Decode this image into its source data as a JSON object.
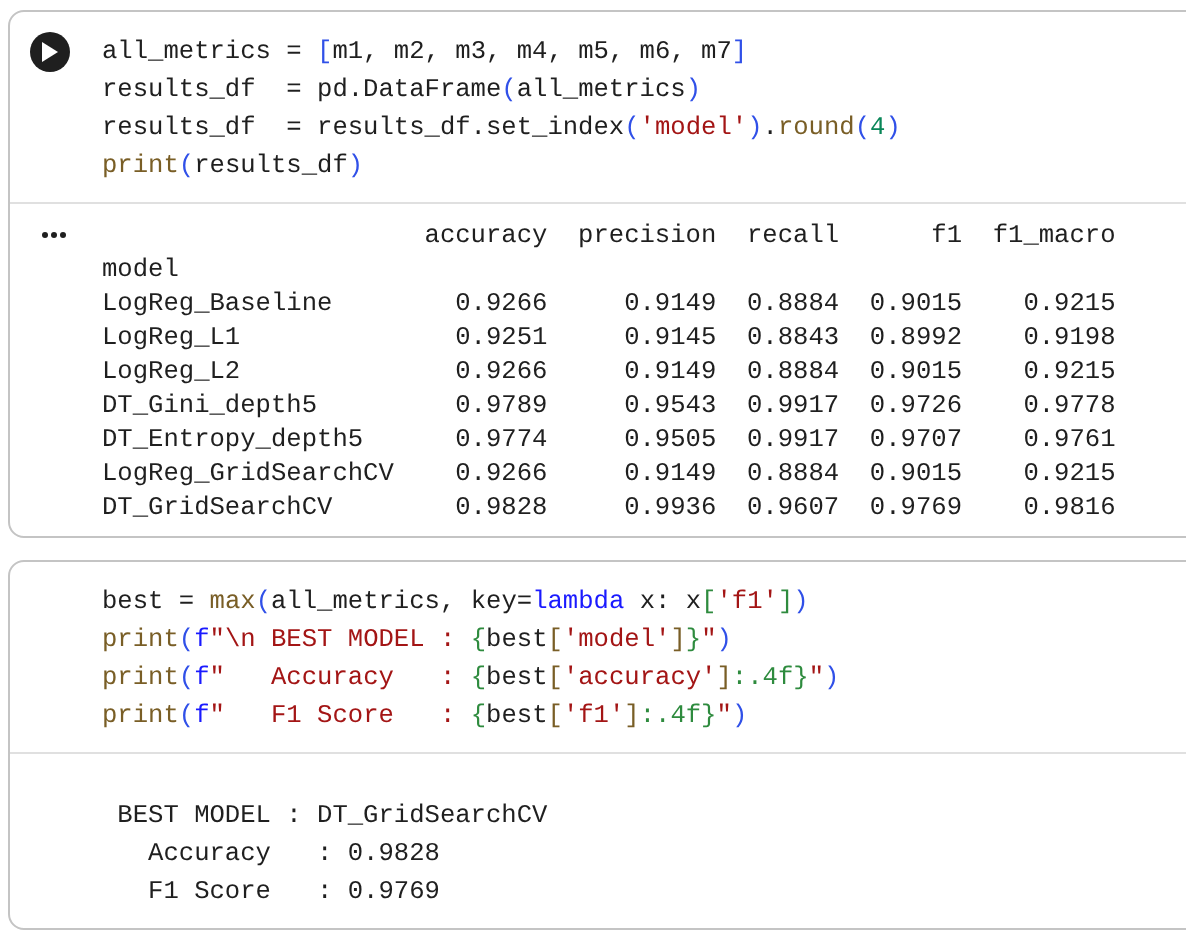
{
  "cells": [
    {
      "code": [
        [
          {
            "text": "all_metrics = ",
            "kind": "plain"
          },
          {
            "text": "[",
            "kind": "bracket"
          },
          {
            "text": "m1, m2, m3, m4, m5, m6, m7",
            "kind": "plain"
          },
          {
            "text": "]",
            "kind": "bracket"
          }
        ],
        [
          {
            "text": "results_df  = pd.DataFrame",
            "kind": "plain"
          },
          {
            "text": "(",
            "kind": "bracket"
          },
          {
            "text": "all_metrics",
            "kind": "plain"
          },
          {
            "text": ")",
            "kind": "bracket"
          }
        ],
        [
          {
            "text": "results_df  = results_df.set_index",
            "kind": "plain"
          },
          {
            "text": "(",
            "kind": "bracket"
          },
          {
            "text": "'model'",
            "kind": "string"
          },
          {
            "text": ")",
            "kind": "bracket"
          },
          {
            "text": ".",
            "kind": "plain"
          },
          {
            "text": "round",
            "kind": "func"
          },
          {
            "text": "(",
            "kind": "bracket"
          },
          {
            "text": "4",
            "kind": "number"
          },
          {
            "text": ")",
            "kind": "bracket"
          }
        ],
        [
          {
            "text": "print",
            "kind": "func"
          },
          {
            "text": "(",
            "kind": "bracket"
          },
          {
            "text": "results_df",
            "kind": "plain"
          },
          {
            "text": ")",
            "kind": "bracket"
          }
        ]
      ],
      "output": {
        "kind": "table",
        "columns": [
          "accuracy",
          "precision",
          "recall",
          "f1",
          "f1_macro"
        ],
        "index_name": "model",
        "rows": [
          {
            "index": "LogReg_Baseline",
            "cells": [
              "0.9266",
              "0.9149",
              "0.8884",
              "0.9015",
              "0.9215"
            ]
          },
          {
            "index": "LogReg_L1",
            "cells": [
              "0.9251",
              "0.9145",
              "0.8843",
              "0.8992",
              "0.9198"
            ]
          },
          {
            "index": "LogReg_L2",
            "cells": [
              "0.9266",
              "0.9149",
              "0.8884",
              "0.9015",
              "0.9215"
            ]
          },
          {
            "index": "DT_Gini_depth5",
            "cells": [
              "0.9789",
              "0.9543",
              "0.9917",
              "0.9726",
              "0.9778"
            ]
          },
          {
            "index": "DT_Entropy_depth5",
            "cells": [
              "0.9774",
              "0.9505",
              "0.9917",
              "0.9707",
              "0.9761"
            ]
          },
          {
            "index": "LogReg_GridSearchCV",
            "cells": [
              "0.9266",
              "0.9149",
              "0.8884",
              "0.9015",
              "0.9215"
            ]
          },
          {
            "index": "DT_GridSearchCV",
            "cells": [
              "0.9828",
              "0.9936",
              "0.9607",
              "0.9769",
              "0.9816"
            ]
          }
        ]
      }
    },
    {
      "code": [
        [
          {
            "text": "best = ",
            "kind": "plain"
          },
          {
            "text": "max",
            "kind": "func"
          },
          {
            "text": "(",
            "kind": "bracket"
          },
          {
            "text": "all_metrics, key=",
            "kind": "plain"
          },
          {
            "text": "lambda",
            "kind": "keyword"
          },
          {
            "text": " x: x",
            "kind": "plain"
          },
          {
            "text": "[",
            "kind": "brace"
          },
          {
            "text": "'f1'",
            "kind": "string"
          },
          {
            "text": "]",
            "kind": "brace"
          },
          {
            "text": ")",
            "kind": "bracket"
          }
        ],
        [
          {
            "text": "print",
            "kind": "func"
          },
          {
            "text": "(",
            "kind": "bracket"
          },
          {
            "text": "f",
            "kind": "keyword"
          },
          {
            "text": "\"\\n BEST MODEL : ",
            "kind": "string"
          },
          {
            "text": "{",
            "kind": "brace"
          },
          {
            "text": "best",
            "kind": "plain"
          },
          {
            "text": "[",
            "kind": "func"
          },
          {
            "text": "'model'",
            "kind": "string"
          },
          {
            "text": "]",
            "kind": "func"
          },
          {
            "text": "}",
            "kind": "brace"
          },
          {
            "text": "\"",
            "kind": "string"
          },
          {
            "text": ")",
            "kind": "bracket"
          }
        ],
        [
          {
            "text": "print",
            "kind": "func"
          },
          {
            "text": "(",
            "kind": "bracket"
          },
          {
            "text": "f",
            "kind": "keyword"
          },
          {
            "text": "\"   Accuracy   : ",
            "kind": "string"
          },
          {
            "text": "{",
            "kind": "brace"
          },
          {
            "text": "best",
            "kind": "plain"
          },
          {
            "text": "[",
            "kind": "func"
          },
          {
            "text": "'accuracy'",
            "kind": "string"
          },
          {
            "text": "]",
            "kind": "func"
          },
          {
            "text": ":.4f}",
            "kind": "brace"
          },
          {
            "text": "\"",
            "kind": "string"
          },
          {
            "text": ")",
            "kind": "bracket"
          }
        ],
        [
          {
            "text": "print",
            "kind": "func"
          },
          {
            "text": "(",
            "kind": "bracket"
          },
          {
            "text": "f",
            "kind": "keyword"
          },
          {
            "text": "\"   F1 Score   : ",
            "kind": "string"
          },
          {
            "text": "{",
            "kind": "brace"
          },
          {
            "text": "best",
            "kind": "plain"
          },
          {
            "text": "[",
            "kind": "func"
          },
          {
            "text": "'f1'",
            "kind": "string"
          },
          {
            "text": "]",
            "kind": "func"
          },
          {
            "text": ":.4f}",
            "kind": "brace"
          },
          {
            "text": "\"",
            "kind": "string"
          },
          {
            "text": ")",
            "kind": "bracket"
          }
        ]
      ],
      "output": {
        "kind": "text",
        "lines": [
          " BEST MODEL : DT_GridSearchCV",
          "   Accuracy   : 0.9828",
          "   F1 Score   : 0.9769"
        ]
      }
    }
  ]
}
